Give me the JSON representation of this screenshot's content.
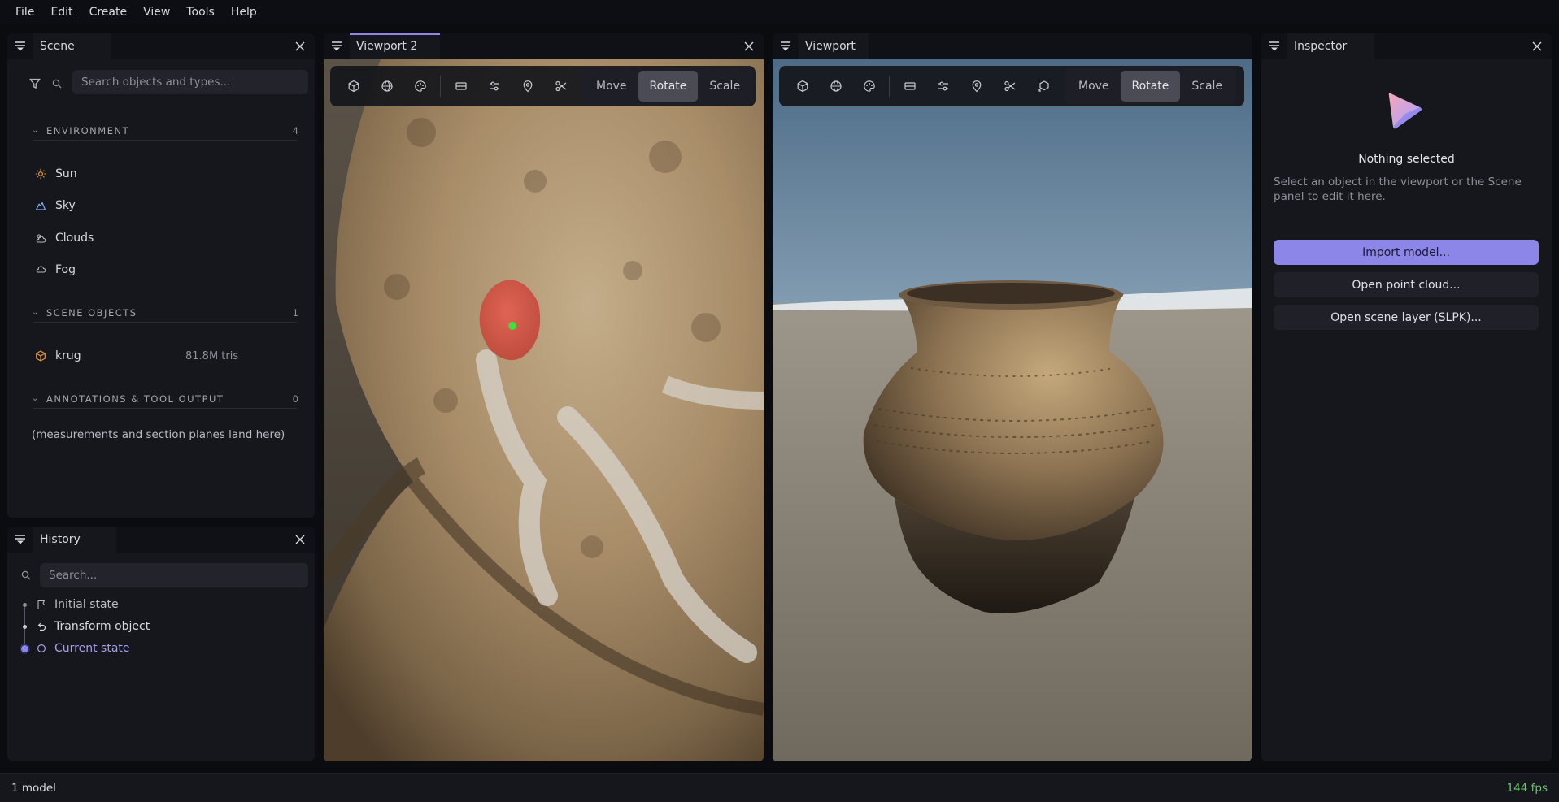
{
  "menubar": {
    "items": [
      "File",
      "Edit",
      "Create",
      "View",
      "Tools",
      "Help"
    ]
  },
  "scene_panel": {
    "tab": "Scene",
    "search_placeholder": "Search objects and types...",
    "sections": [
      {
        "title": "ENVIRONMENT",
        "count": "4"
      },
      {
        "title": "SCENE OBJECTS",
        "count": "1"
      },
      {
        "title": "ANNOTATIONS & TOOL OUTPUT",
        "count": "0"
      }
    ],
    "environment": [
      {
        "label": "Sun",
        "icon": "sun-icon"
      },
      {
        "label": "Sky",
        "icon": "sky-icon"
      },
      {
        "label": "Clouds",
        "icon": "clouds-icon"
      },
      {
        "label": "Fog",
        "icon": "fog-icon"
      }
    ],
    "objects": [
      {
        "label": "krug",
        "meta": "81.8M tris",
        "icon": "cube-icon"
      }
    ],
    "annotations_empty": "(measurements and section planes land here)"
  },
  "history_panel": {
    "tab": "History",
    "search_placeholder": "Search...",
    "items": [
      {
        "label": "Initial state",
        "icon": "flag-icon"
      },
      {
        "label": "Transform object",
        "icon": "undo-icon"
      },
      {
        "label": "Current state",
        "icon": "circle-icon"
      }
    ]
  },
  "viewport2": {
    "tab": "Viewport 2"
  },
  "viewport": {
    "tab": "Viewport"
  },
  "toolbar": {
    "modes": [
      "Move",
      "Rotate",
      "Scale"
    ],
    "selected_mode": "Rotate"
  },
  "inspector": {
    "tab": "Inspector",
    "title": "Nothing selected",
    "description": "Select an object in the viewport or the Scene panel to edit it here.",
    "buttons": [
      "Import model...",
      "Open point cloud...",
      "Open scene layer (SLPK)..."
    ]
  },
  "statusbar": {
    "left": "1 model",
    "right": "144 fps"
  },
  "colors": {
    "accent": "#8b86e8",
    "fps": "#6cc46c",
    "orange": "#e3973a"
  }
}
